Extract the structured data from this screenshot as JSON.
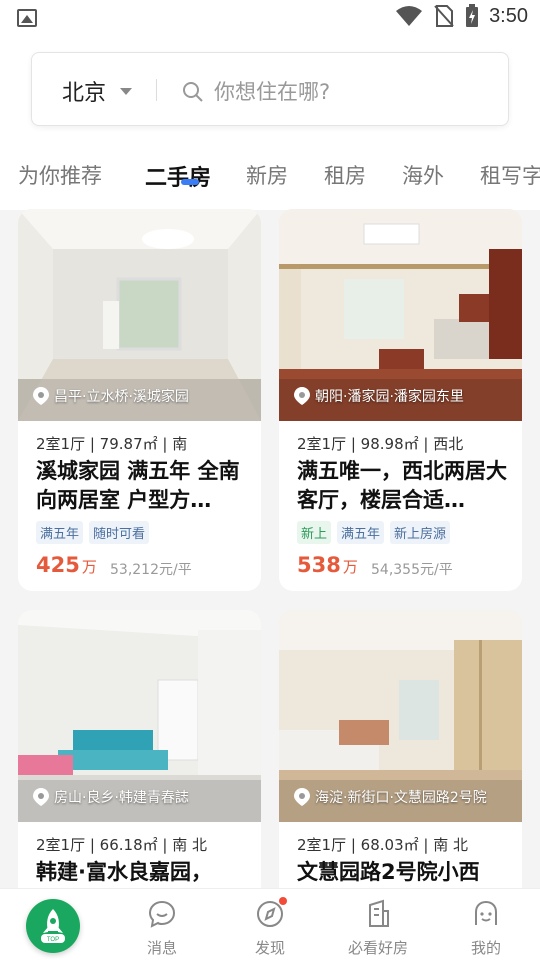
{
  "status": {
    "time": "3:50"
  },
  "search": {
    "city": "北京",
    "placeholder": "你想住在哪?"
  },
  "tabs": [
    "为你推荐",
    "二手房",
    "新房",
    "租房",
    "海外",
    "租写字楼"
  ],
  "active_tab": "二手房",
  "listings": [
    {
      "location": "昌平·立水桥·溪城家园",
      "meta": "2室1厅 | 79.87㎡ | 南",
      "title": "溪城家园 满五年 全南向两居室 户型方…",
      "tags": [
        "满五年",
        "随时可看"
      ],
      "price": "425",
      "price_unit": "万",
      "unit_price": "53,212元/平"
    },
    {
      "location": "朝阳·潘家园·潘家园东里",
      "meta": "2室1厅 | 98.98㎡ | 西北",
      "title": "满五唯一，西北两居大客厅，楼层合适…",
      "tags": [
        "新上",
        "满五年",
        "新上房源"
      ],
      "price": "538",
      "price_unit": "万",
      "unit_price": "54,355元/平"
    },
    {
      "location": "房山·良乡·韩建青春誌",
      "meta": "2室1厅 | 66.18㎡ | 南 北",
      "title": "韩建·富水良嘉园，"
    },
    {
      "location": "海淀·新街口·文慧园路2号院",
      "meta": "2室1厅 | 68.03㎡ | 南 北",
      "title": "文慧园路2号院小西"
    }
  ],
  "bottom_nav": {
    "fab_label": "TOP",
    "items": [
      "消息",
      "发现",
      "必看好房",
      "我的"
    ]
  },
  "colors": {
    "accent": "#3a7df5",
    "price": "#e65a3c",
    "fab": "#1aa860"
  }
}
